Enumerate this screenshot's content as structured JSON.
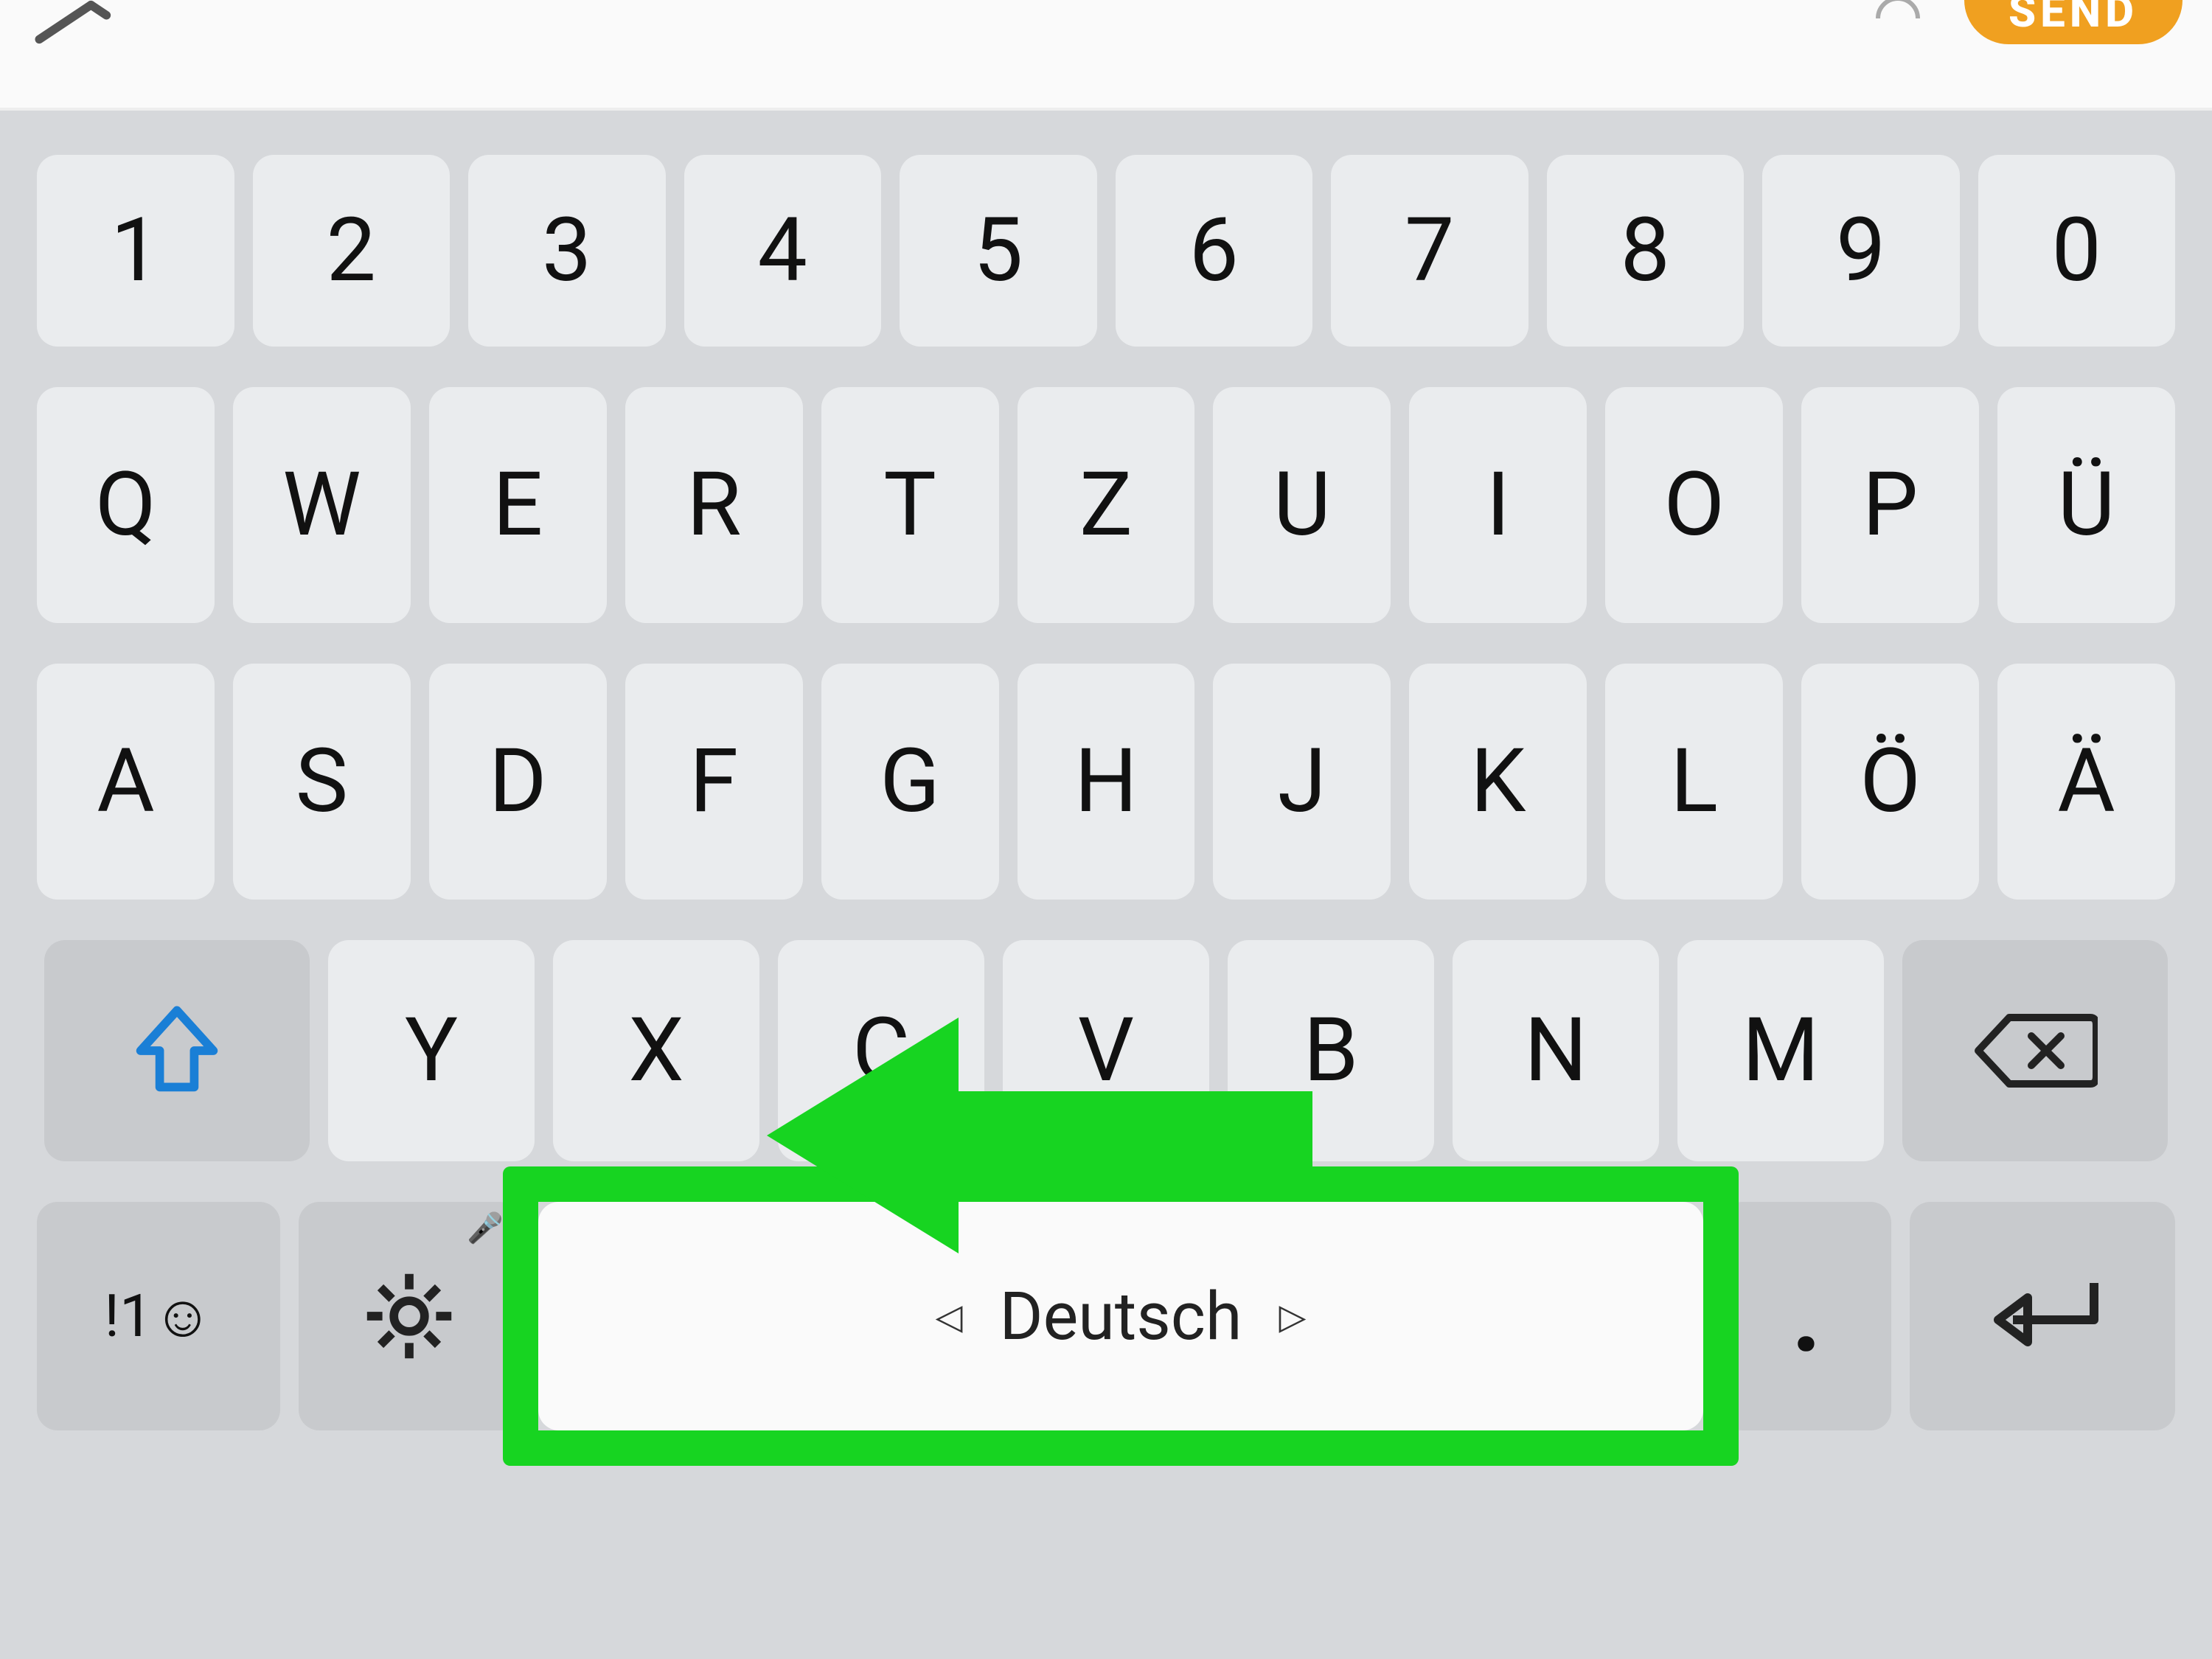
{
  "topbar": {
    "send_label": "SEND"
  },
  "keyboard": {
    "row_numbers": [
      "1",
      "2",
      "3",
      "4",
      "5",
      "6",
      "7",
      "8",
      "9",
      "0"
    ],
    "row_top": [
      "Q",
      "W",
      "E",
      "R",
      "T",
      "Z",
      "U",
      "I",
      "O",
      "P",
      "Ü"
    ],
    "row_home": [
      "A",
      "S",
      "D",
      "F",
      "G",
      "H",
      "J",
      "K",
      "L",
      "Ö",
      "Ä"
    ],
    "row_lower": [
      "Y",
      "X",
      "C",
      "V",
      "B",
      "N",
      "M"
    ],
    "sym_toggle": "!1☺",
    "period": ".",
    "space_language": "Deutsch",
    "space_left_glyph": "◁",
    "space_right_glyph": "▷"
  },
  "annotation": {
    "arrow_color": "#17d421",
    "highlight_color": "#17d421"
  }
}
